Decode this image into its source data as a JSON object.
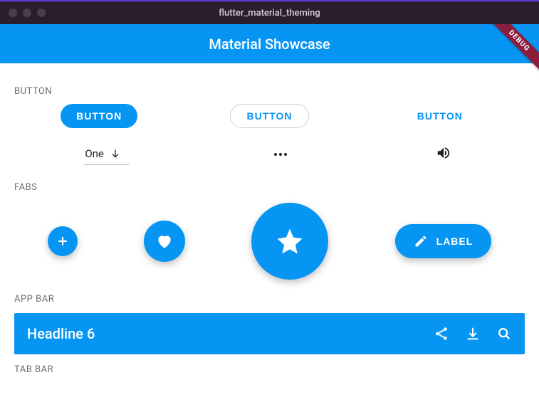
{
  "window": {
    "title": "flutter_material_theming"
  },
  "debug_banner": "DEBUG",
  "header": {
    "title": "Material Showcase"
  },
  "colors": {
    "primary": "#0795f4"
  },
  "sections": {
    "button": {
      "label": "BUTTON",
      "filled": "BUTTON",
      "outlined": "BUTTON",
      "text": "BUTTON",
      "dropdown_value": "One",
      "more_icon": "more-horiz",
      "sound_icon": "volume-up"
    },
    "fabs": {
      "label": "FABS",
      "mini_icon": "plus",
      "normal_icon": "heart",
      "large_icon": "star",
      "extended_icon": "edit",
      "extended_label": "LABEL"
    },
    "appbar": {
      "label": "APP BAR",
      "title": "Headline 6",
      "actions": [
        "share",
        "download",
        "search"
      ]
    },
    "tabbar": {
      "label": "TAB BAR"
    }
  }
}
